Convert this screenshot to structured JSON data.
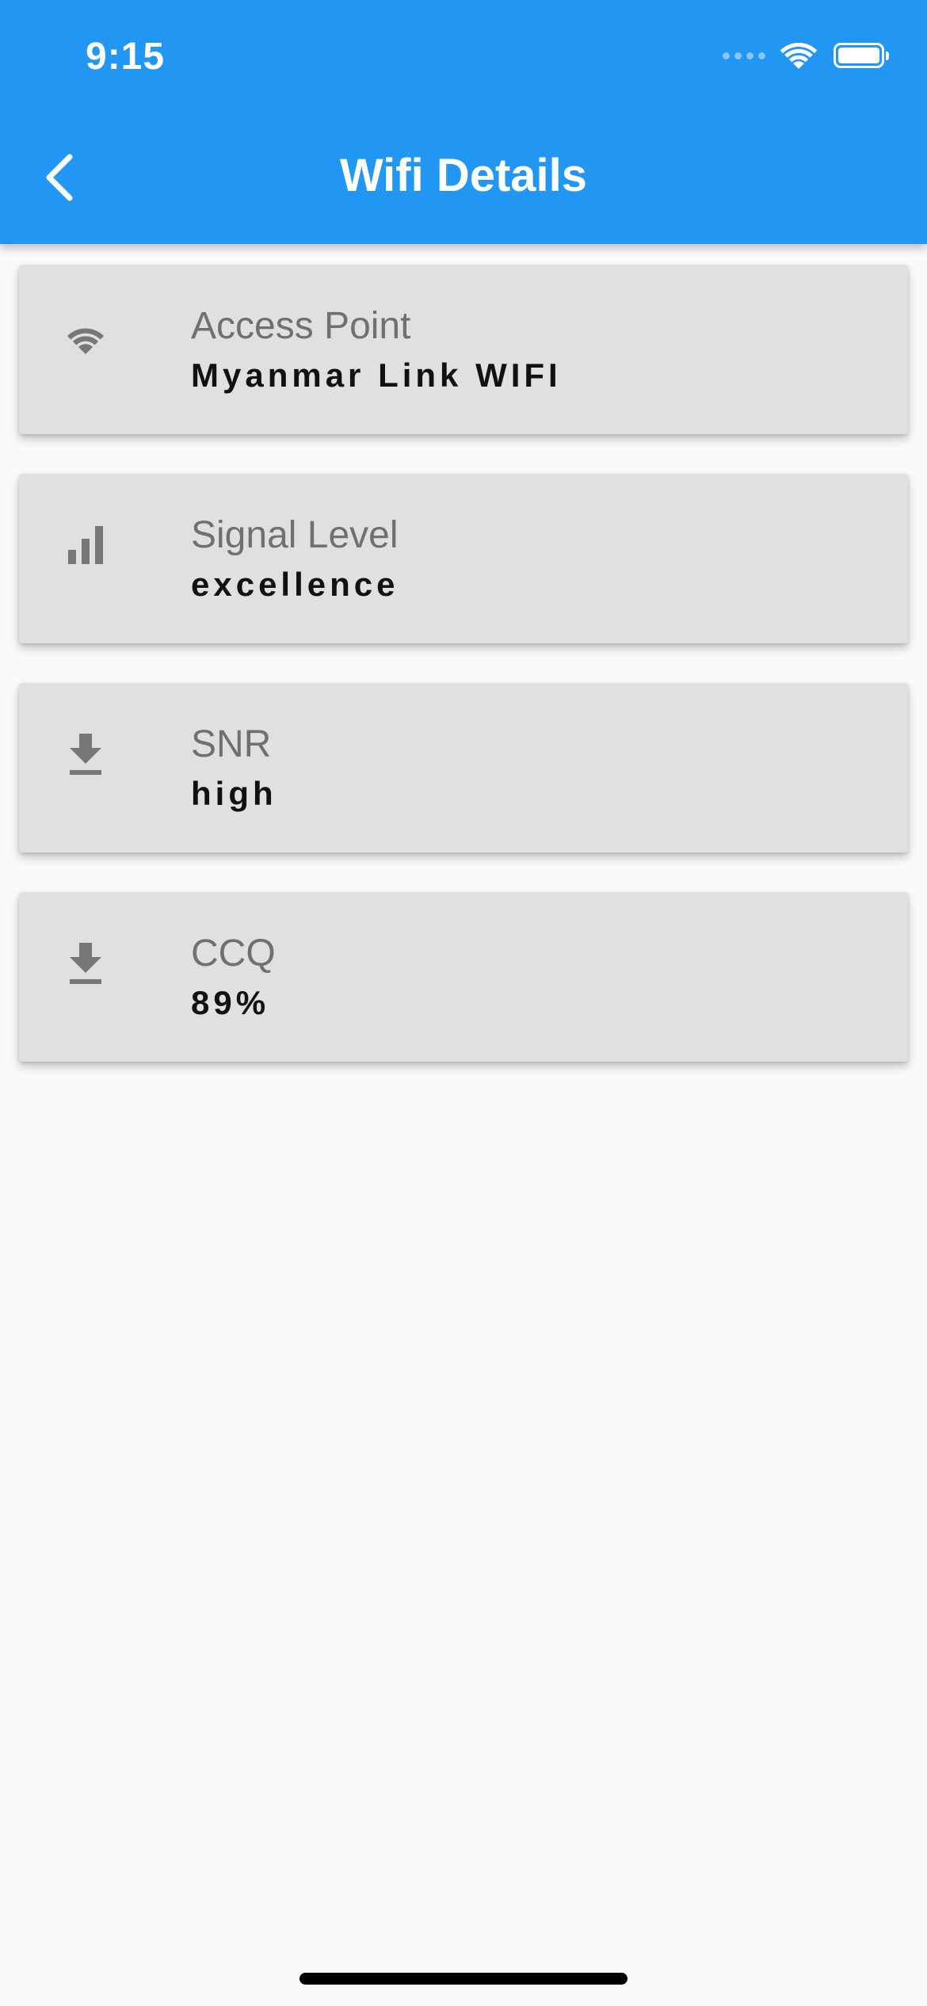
{
  "status_bar": {
    "time": "9:15",
    "icons": [
      "cellular-dots-icon",
      "wifi-icon",
      "battery-icon"
    ]
  },
  "app_bar": {
    "title": "Wifi Details",
    "back_icon": "chevron-left-icon",
    "color": "#2196f3"
  },
  "cards": [
    {
      "icon": "wifi-icon",
      "label": "Access Point",
      "value": "Myanmar Link WIFI"
    },
    {
      "icon": "signal-bars-icon",
      "label": "Signal Level",
      "value": "excellence"
    },
    {
      "icon": "download-icon",
      "label": "SNR",
      "value": "high"
    },
    {
      "icon": "download-icon",
      "label": "CCQ",
      "value": "89%"
    }
  ]
}
